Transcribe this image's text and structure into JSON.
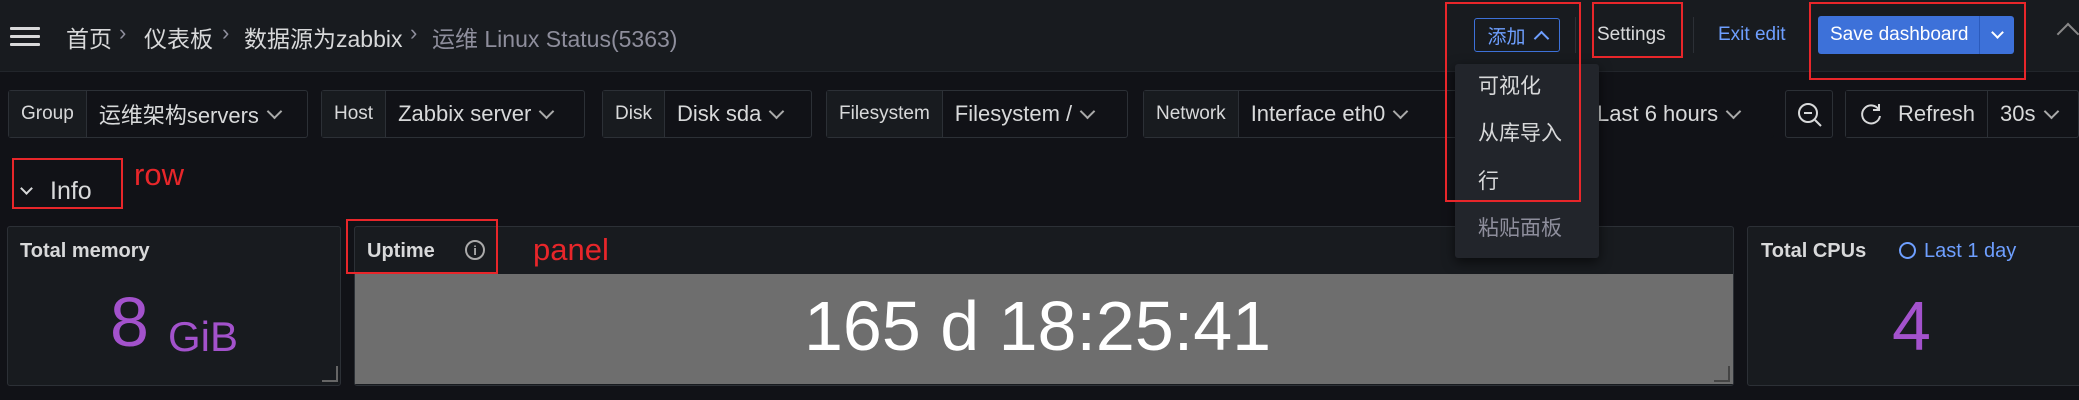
{
  "breadcrumb": {
    "home": "首页",
    "dashboards": "仪表板",
    "folder": "数据源为zabbix",
    "current": "运维 Linux Status(5363)"
  },
  "toolbar": {
    "add_label": "添加",
    "settings_label": "Settings",
    "exit_edit_label": "Exit edit",
    "save_label": "Save dashboard"
  },
  "add_menu": {
    "items": [
      "可视化",
      "从库导入",
      "行",
      "粘贴面板"
    ]
  },
  "variables": [
    {
      "label": "Group",
      "value": "运维架构servers"
    },
    {
      "label": "Host",
      "value": "Zabbix server"
    },
    {
      "label": "Disk",
      "value": "Disk sda"
    },
    {
      "label": "Filesystem",
      "value": "Filesystem /"
    },
    {
      "label": "Network",
      "value": "Interface eth0"
    }
  ],
  "time": {
    "range": "Last 6 hours",
    "refresh_label": "Refresh",
    "interval": "30s"
  },
  "row": {
    "title": "Info"
  },
  "panels": {
    "memory": {
      "title": "Total memory",
      "value": "8",
      "unit": "GiB"
    },
    "uptime": {
      "title": "Uptime",
      "value": "165 d 18:25:41"
    },
    "cpus": {
      "title": "Total CPUs",
      "time_override": "Last 1 day",
      "value": "4"
    }
  },
  "annotations": {
    "row": "row",
    "panel": "panel"
  },
  "colors": {
    "accent_blue": "#3d71d9",
    "value_purple": "#a352cc",
    "annotation_red": "#e8262a",
    "uptime_bg": "#6e6e6e"
  }
}
